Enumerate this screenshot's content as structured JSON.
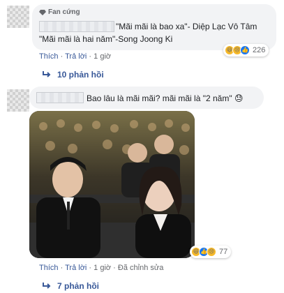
{
  "comment1": {
    "badge": "Fan cứng",
    "text_line1": "\"Mãi mãi là bao xa\"- Diệp Lạc Vô Tâm",
    "text_line2": "\"Mãi mãi là hai năm\"-Song Joong Ki",
    "actions": {
      "like": "Thích",
      "reply": "Trả lời",
      "time": "1 giờ"
    },
    "reaction_count": "226",
    "reactions": [
      "haha-icon",
      "sad-icon",
      "like-icon"
    ],
    "replies_label": "10 phản hồi"
  },
  "comment2": {
    "text": "Bao lâu là mãi mãi? mãi mãi là \"2 năm\" 😓",
    "image_alt": "photo",
    "actions": {
      "like": "Thích",
      "reply": "Trả lời",
      "time": "1 giờ",
      "edited": "Đã chỉnh sửa"
    },
    "reaction_count": "77",
    "reactions": [
      "haha-icon",
      "like-icon",
      "sad-icon"
    ],
    "replies_label": "7 phản hồi"
  },
  "colors": {
    "link": "#385898",
    "meta": "#65676b",
    "bubble": "#f2f3f5"
  }
}
